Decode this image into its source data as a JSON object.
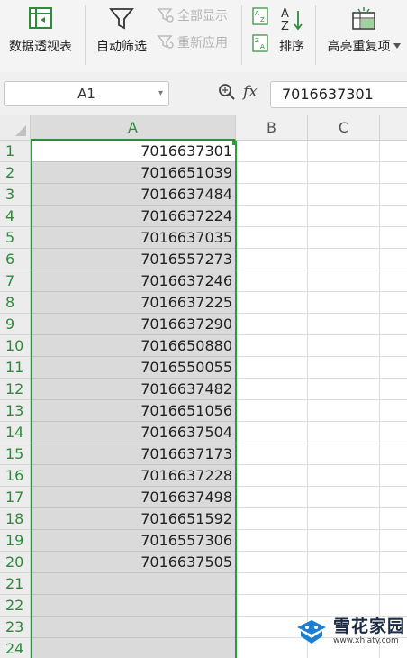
{
  "ribbon": {
    "pivot_label": "数据透视表",
    "autofilter_label": "自动筛选",
    "show_all_label": "全部显示",
    "reapply_label": "重新应用",
    "sort_label": "排序",
    "highlight_dup_label": "高亮重复项",
    "icons": [
      "pivot-table-icon",
      "funnel-icon",
      "show-all-icon",
      "reapply-icon",
      "sort-az-icon",
      "sort-za-icon",
      "sort-icon",
      "highlight-duplicates-icon",
      "chevron-down-icon"
    ]
  },
  "formula_bar": {
    "name_box": "A1",
    "fx": "fx",
    "value": "7016637301"
  },
  "columns": [
    "A",
    "B",
    "C"
  ],
  "rows": [
    "1",
    "2",
    "3",
    "4",
    "5",
    "6",
    "7",
    "8",
    "9",
    "10",
    "11",
    "12",
    "13",
    "14",
    "15",
    "16",
    "17",
    "18",
    "19",
    "20",
    "21",
    "22",
    "23",
    "24"
  ],
  "cells_A": [
    "7016637301",
    "7016651039",
    "7016637484",
    "7016637224",
    "7016637035",
    "7016557273",
    "7016637246",
    "7016637225",
    "7016637290",
    "7016650880",
    "7016550055",
    "7016637482",
    "7016651056",
    "7016637504",
    "7016637173",
    "7016637228",
    "7016637498",
    "7016651592",
    "7016557306",
    "7016637505",
    "",
    "",
    "",
    ""
  ],
  "watermark": {
    "name": "雪花家园",
    "url": "www.xhjaty.com"
  },
  "colors": {
    "accent_green": "#2e9b3a",
    "selected_fill": "#dadada"
  }
}
